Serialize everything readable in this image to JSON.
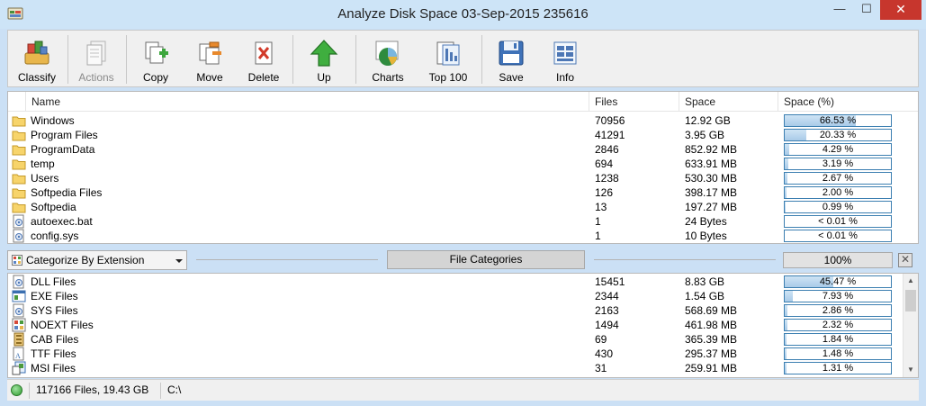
{
  "window": {
    "title": "Analyze Disk Space 03-Sep-2015 235616",
    "minimize_glyph": "—",
    "maximize_glyph": "☐",
    "close_glyph": "✕"
  },
  "toolbar": [
    {
      "id": "classify",
      "label": "Classify",
      "icon": "classify-icon",
      "disabled": false
    },
    {
      "id": "actions",
      "label": "Actions",
      "icon": "actions-icon",
      "disabled": true
    },
    {
      "id": "copy",
      "label": "Copy",
      "icon": "copy-icon",
      "disabled": false
    },
    {
      "id": "move",
      "label": "Move",
      "icon": "move-icon",
      "disabled": false
    },
    {
      "id": "delete",
      "label": "Delete",
      "icon": "delete-icon",
      "disabled": false
    },
    {
      "id": "up",
      "label": "Up",
      "icon": "up-arrow-icon",
      "disabled": false
    },
    {
      "id": "charts",
      "label": "Charts",
      "icon": "pie-chart-icon",
      "disabled": false
    },
    {
      "id": "top100",
      "label": "Top 100",
      "icon": "top100-icon",
      "disabled": false
    },
    {
      "id": "save",
      "label": "Save",
      "icon": "floppy-disk-icon",
      "disabled": false
    },
    {
      "id": "info",
      "label": "Info",
      "icon": "info-icon",
      "disabled": false
    }
  ],
  "top_table": {
    "columns": [
      "Name",
      "Files",
      "Space",
      "Space (%)"
    ],
    "rows": [
      {
        "icon": "folder-icon",
        "name": "Windows",
        "files": "70956",
        "space": "12.92 GB",
        "pct_text": "66.53 %",
        "pct": 66.53
      },
      {
        "icon": "folder-icon",
        "name": "Program Files",
        "files": "41291",
        "space": "3.95 GB",
        "pct_text": "20.33 %",
        "pct": 20.33
      },
      {
        "icon": "folder-icon",
        "name": "ProgramData",
        "files": "2846",
        "space": "852.92 MB",
        "pct_text": "4.29 %",
        "pct": 4.29
      },
      {
        "icon": "folder-icon",
        "name": "temp",
        "files": "694",
        "space": "633.91 MB",
        "pct_text": "3.19 %",
        "pct": 3.19
      },
      {
        "icon": "folder-icon",
        "name": "Users",
        "files": "1238",
        "space": "530.30 MB",
        "pct_text": "2.67 %",
        "pct": 2.67
      },
      {
        "icon": "folder-icon",
        "name": "Softpedia Files",
        "files": "126",
        "space": "398.17 MB",
        "pct_text": "2.00 %",
        "pct": 2.0
      },
      {
        "icon": "folder-icon",
        "name": "Softpedia",
        "files": "13",
        "space": "197.27 MB",
        "pct_text": "0.99 %",
        "pct": 0.99
      },
      {
        "icon": "system-file-icon",
        "name": "autoexec.bat",
        "files": "1",
        "space": "24 Bytes",
        "pct_text": "< 0.01 %",
        "pct": 0
      },
      {
        "icon": "system-file-icon",
        "name": "config.sys",
        "files": "1",
        "space": "10 Bytes",
        "pct_text": "< 0.01 %",
        "pct": 0
      }
    ]
  },
  "middle_bar": {
    "categorize_select": "Categorize By Extension",
    "file_categories_button": "File Categories",
    "percent": "100%",
    "close_glyph": "✕"
  },
  "bottom_table": {
    "rows": [
      {
        "icon": "dll-file-icon",
        "name": "DLL Files",
        "files": "15451",
        "space": "8.83 GB",
        "pct_text": "45.47 %",
        "pct": 45.47
      },
      {
        "icon": "exe-file-icon",
        "name": "EXE Files",
        "files": "2344",
        "space": "1.54 GB",
        "pct_text": "7.93 %",
        "pct": 7.93
      },
      {
        "icon": "sys-file-icon",
        "name": "SYS Files",
        "files": "2163",
        "space": "568.69 MB",
        "pct_text": "2.86 %",
        "pct": 2.86
      },
      {
        "icon": "noext-file-icon",
        "name": "NOEXT Files",
        "files": "1494",
        "space": "461.98 MB",
        "pct_text": "2.32 %",
        "pct": 2.32
      },
      {
        "icon": "cab-file-icon",
        "name": "CAB Files",
        "files": "69",
        "space": "365.39 MB",
        "pct_text": "1.84 %",
        "pct": 1.84
      },
      {
        "icon": "ttf-file-icon",
        "name": "TTF Files",
        "files": "430",
        "space": "295.37 MB",
        "pct_text": "1.48 %",
        "pct": 1.48
      },
      {
        "icon": "msi-file-icon",
        "name": "MSI Files",
        "files": "31",
        "space": "259.91 MB",
        "pct_text": "1.31 %",
        "pct": 1.31
      }
    ]
  },
  "statusbar": {
    "summary": "117166 Files, 19.43 GB",
    "path": "C:\\"
  }
}
